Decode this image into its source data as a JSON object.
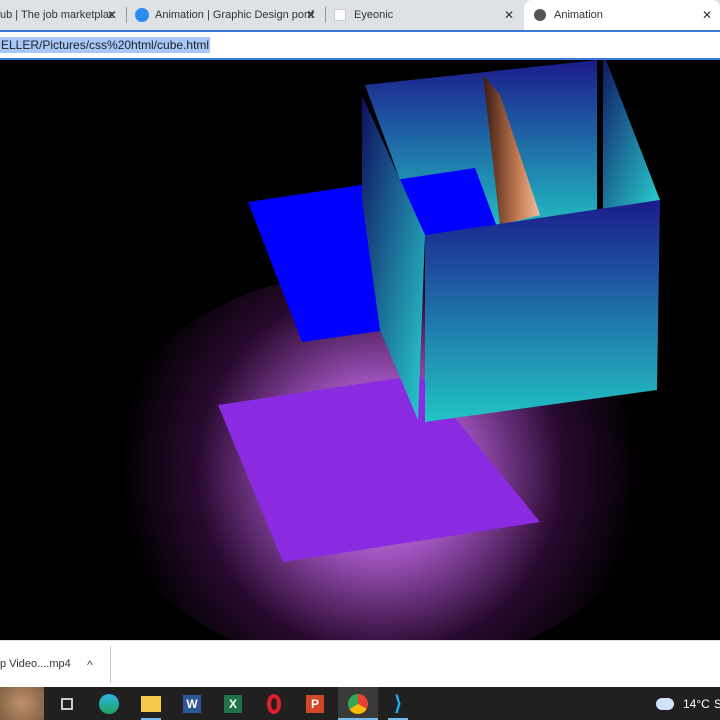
{
  "browser": {
    "tabs": [
      {
        "label": "ub | The job marketplac",
        "icon": "site-icon"
      },
      {
        "label": "Animation | Graphic Design portf",
        "icon": "behance-icon"
      },
      {
        "label": "Eyeonic",
        "icon": "page-icon"
      },
      {
        "label": "Animation",
        "icon": "globe-icon",
        "active": true
      }
    ],
    "close_glyph": "✕",
    "url": "ELLER/Pictures/css%20html/cube.html"
  },
  "download_bar": {
    "file": "p Video....mp4",
    "chevron": "^"
  },
  "taskbar": {
    "apps": [
      "task-view",
      "edge",
      "file-explorer",
      "word",
      "excel",
      "opera",
      "powerpoint",
      "chrome",
      "vscode"
    ],
    "weather": "14°C",
    "weather_extra": "S"
  },
  "colors": {
    "purple": "#8a2be2",
    "blue": "#0000ff",
    "navy": "#1b1b8c",
    "teal": "#22c4c4"
  }
}
